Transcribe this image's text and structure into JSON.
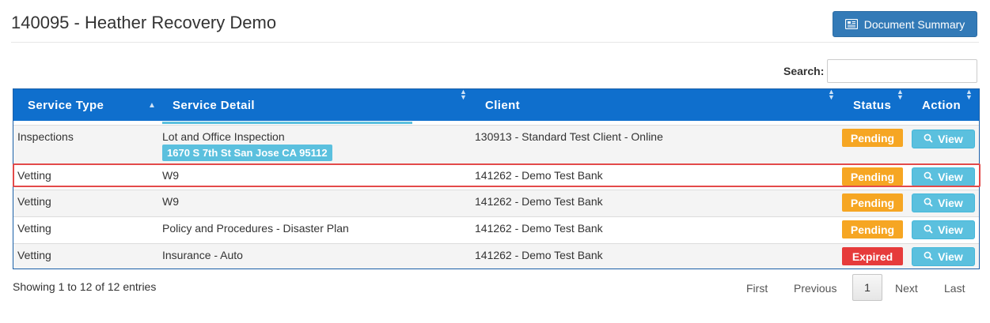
{
  "page": {
    "title": "140095 - Heather Recovery Demo",
    "document_summary_label": "Document Summary"
  },
  "search": {
    "label": "Search:",
    "value": "",
    "placeholder": ""
  },
  "table": {
    "columns": [
      "Service Type",
      "Service Detail",
      "Client",
      "Status",
      "Action"
    ],
    "rows": [
      {
        "service_type": "Inspections",
        "service_detail": "Lot and Office Inspection",
        "address": "1670 S 7th St San Jose CA 95112",
        "client": "130913 - Standard Test Client - Online",
        "status": "Pending",
        "action": "View"
      },
      {
        "service_type": "Vetting",
        "service_detail": "W9",
        "client": "141262 - Demo Test Bank",
        "status": "Pending",
        "action": "View"
      },
      {
        "service_type": "Vetting",
        "service_detail": "W9",
        "client": "141262 - Demo Test Bank",
        "status": "Pending",
        "action": "View"
      },
      {
        "service_type": "Vetting",
        "service_detail": "Policy and Procedures - Disaster Plan",
        "client": "141262 - Demo Test Bank",
        "status": "Pending",
        "action": "View"
      },
      {
        "service_type": "Vetting",
        "service_detail": "Insurance - Auto",
        "client": "141262 - Demo Test Bank",
        "status": "Expired",
        "action": "View"
      }
    ]
  },
  "footer": {
    "info": "Showing 1 to 12 of 12 entries",
    "pagination": {
      "first": "First",
      "previous": "Previous",
      "current": "1",
      "next": "Next",
      "last": "Last"
    }
  },
  "colors": {
    "header": "#0f6fcd",
    "pending": "#f6a623",
    "expired": "#e63b3b",
    "view": "#5bc0de",
    "primary": "#337ab7",
    "highlight": "#e34a4a"
  },
  "icons": {
    "document_summary": "newspaper-icon",
    "view": "search-icon",
    "sort": "sort-arrows-icon"
  }
}
